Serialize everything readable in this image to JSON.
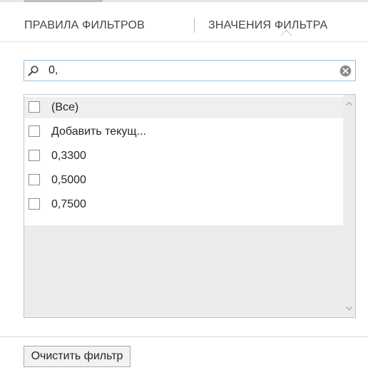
{
  "tabs": {
    "rules_label": "ПРАВИЛА ФИЛЬТРОВ",
    "values_label": "ЗНАЧЕНИЯ ФИЛЬТРА",
    "active": "values"
  },
  "search": {
    "value": "0,",
    "icon": "search-icon",
    "clear_icon": "clear-icon"
  },
  "list": {
    "items": [
      {
        "label": "(Все)",
        "checked": false
      },
      {
        "label": "Добавить текущ...",
        "checked": false
      },
      {
        "label": "0,3300",
        "checked": false
      },
      {
        "label": "0,5000",
        "checked": false
      },
      {
        "label": "0,7500",
        "checked": false
      }
    ]
  },
  "buttons": {
    "clear_filter_label": "Очистить фильтр"
  },
  "colors": {
    "search_border": "#99bde0",
    "list_background": "#ececec",
    "selected_row": "#efefef",
    "checkbox_border": "#8e8e8e"
  }
}
